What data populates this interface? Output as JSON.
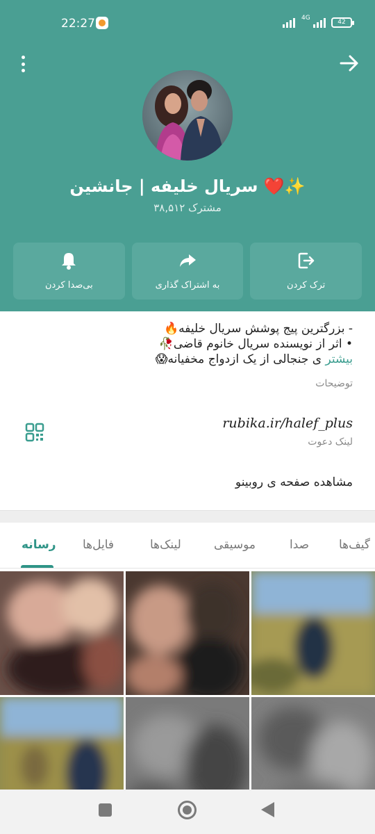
{
  "status_bar": {
    "time": "22:27",
    "network_label": "4G",
    "battery": "42"
  },
  "header": {
    "title": "سریال خلیفه | جانشین ❤️✨",
    "subscribers": "۳۸,۵۱۲ مشترک",
    "background_color": "#4a9f93",
    "more_icon": "vertical-dots-icon",
    "back_icon": "arrow-right-icon"
  },
  "actions": [
    {
      "label": "ترک کردن",
      "icon": "leave-icon"
    },
    {
      "label": "به اشتراک گذاری",
      "icon": "share-icon"
    },
    {
      "label": "بی‌صدا کردن",
      "icon": "bell-icon"
    }
  ],
  "info": {
    "description_lines": [
      "- بزرگترین پیج پوشش سریال خلیفه🔥",
      "• اثر از نویسنده سریال خانوم قاضی🥀",
      "ی جنجالی از یک ازدواج مخفیانه😱"
    ],
    "description_more": "بیشتر",
    "description_label": "توضیحات",
    "invite_link": "rubika.ir/halef_plus",
    "invite_link_label": "لینک دعوت",
    "rubino_link": "مشاهده صفحه ی روبینو"
  },
  "tabs": [
    {
      "label": "رسانه",
      "active": true
    },
    {
      "label": "فایل‌ها",
      "active": false
    },
    {
      "label": "لینک‌ها",
      "active": false
    },
    {
      "label": "موسیقی",
      "active": false
    },
    {
      "label": "صدا",
      "active": false
    },
    {
      "label": "گیف‌ها",
      "active": false
    }
  ],
  "accent_color": "#2f9487"
}
